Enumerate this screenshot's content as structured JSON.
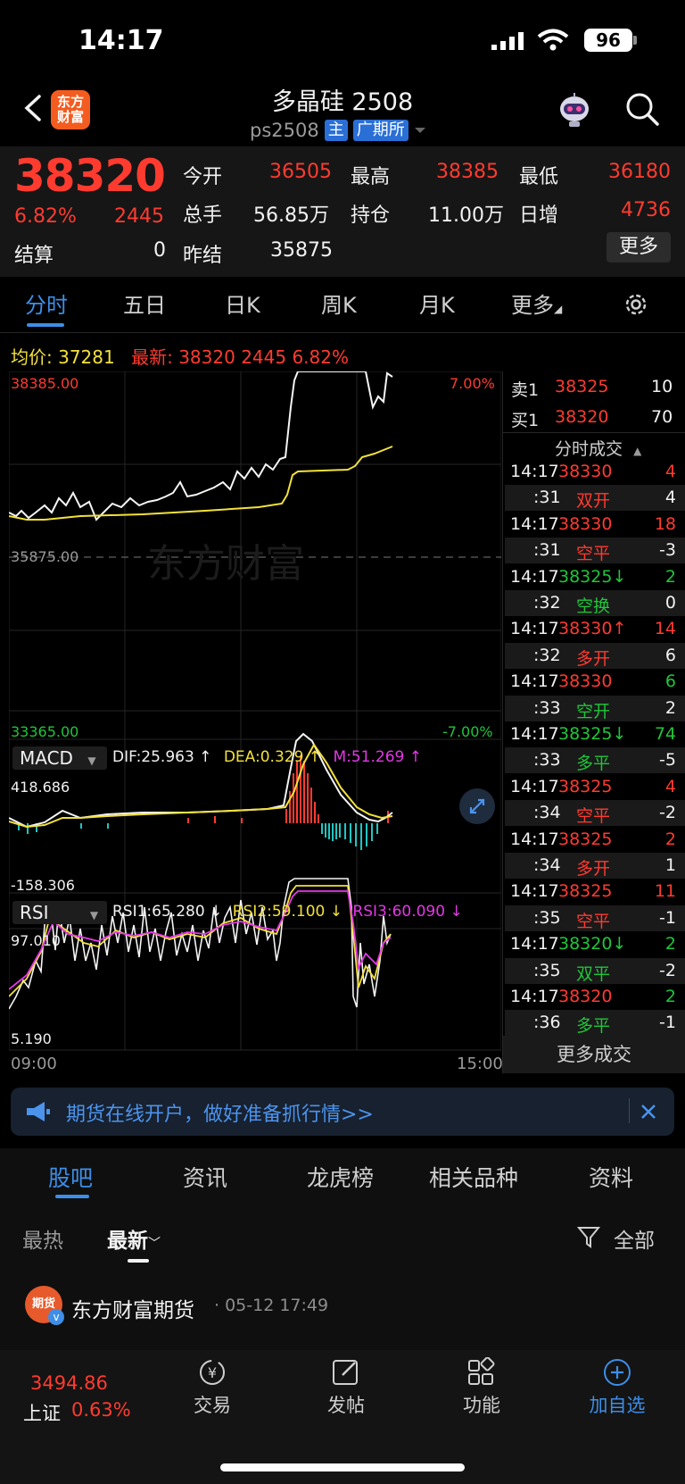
{
  "status_bar": {
    "time": "14:17",
    "battery": "96"
  },
  "header": {
    "logo_text": "东方财富",
    "title": "多晶硅 2508",
    "code": "ps2508",
    "tag_main": "主",
    "exchange": "广期所"
  },
  "quote": {
    "last_price": "38320",
    "change_pct": "6.82%",
    "change": "2445",
    "open_label": "今开",
    "open": "36505",
    "high_label": "最高",
    "high": "38385",
    "low_label": "最低",
    "low": "36180",
    "volume_label": "总手",
    "volume": "56.85万",
    "oi_label": "持仓",
    "oi": "11.00万",
    "daily_inc_label": "日增",
    "daily_inc": "4736",
    "settle_label": "结算",
    "settle": "0",
    "prev_settle_label": "昨结",
    "prev_settle": "35875",
    "more_label": "更多"
  },
  "tabs": [
    "分时",
    "五日",
    "日K",
    "周K",
    "月K",
    "更多"
  ],
  "avg_info": {
    "avg_label": "均价:",
    "avg": "37281",
    "latest_label": "最新:",
    "latest": "38320",
    "latest_chg": "2445",
    "latest_pct": "6.82%"
  },
  "price_chart": {
    "top_label": "38385.00",
    "top_pct": "7.00%",
    "mid_label": "35875.00",
    "bottom_label": "33365.00",
    "bottom_pct": "-7.00%",
    "watermark": "东方财富",
    "time_start": "09:00",
    "time_end": "15:00"
  },
  "macd": {
    "name": "MACD",
    "dif": "DIF:25.963 ↑",
    "dea": "DEA:0.329 ↑",
    "m": "M:51.269 ↑",
    "top": "418.686",
    "bottom": "-158.306"
  },
  "rsi": {
    "name": "RSI",
    "rsi1": "RSI1:65.280 ↓",
    "rsi2": "RSI2:59.100 ↓",
    "rsi3": "RSI3:60.090 ↓",
    "top": "97.010",
    "bottom": "5.190"
  },
  "order_book": {
    "sell_label": "卖1",
    "sell_price": "38325",
    "sell_vol": "10",
    "buy_label": "买1",
    "buy_price": "38320",
    "buy_vol": "70",
    "ticks_header": "分时成交",
    "more_trades": "更多成交",
    "ticks": [
      {
        "time": "14:17",
        "price": "38330",
        "price_color": "red",
        "vol": "4",
        "vol_color": "red"
      },
      {
        "time": ":31",
        "price": "双开",
        "price_color": "red",
        "vol": "4",
        "vol_color": "white"
      },
      {
        "time": "14:17",
        "price": "38330",
        "price_color": "red",
        "vol": "18",
        "vol_color": "red"
      },
      {
        "time": ":31",
        "price": "空平",
        "price_color": "red",
        "vol": "-3",
        "vol_color": "white"
      },
      {
        "time": "14:17",
        "price": "38325↓",
        "price_color": "green",
        "vol": "2",
        "vol_color": "green"
      },
      {
        "time": ":32",
        "price": "空换",
        "price_color": "green",
        "vol": "0",
        "vol_color": "white"
      },
      {
        "time": "14:17",
        "price": "38330↑",
        "price_color": "red",
        "vol": "14",
        "vol_color": "red"
      },
      {
        "time": ":32",
        "price": "多开",
        "price_color": "red",
        "vol": "6",
        "vol_color": "white"
      },
      {
        "time": "14:17",
        "price": "38330",
        "price_color": "red",
        "vol": "6",
        "vol_color": "green"
      },
      {
        "time": ":33",
        "price": "空开",
        "price_color": "green",
        "vol": "2",
        "vol_color": "white"
      },
      {
        "time": "14:17",
        "price": "38325↓",
        "price_color": "green",
        "vol": "74",
        "vol_color": "green"
      },
      {
        "time": ":33",
        "price": "多平",
        "price_color": "green",
        "vol": "-5",
        "vol_color": "white"
      },
      {
        "time": "14:17",
        "price": "38325",
        "price_color": "red",
        "vol": "4",
        "vol_color": "red"
      },
      {
        "time": ":34",
        "price": "空平",
        "price_color": "red",
        "vol": "-2",
        "vol_color": "white"
      },
      {
        "time": "14:17",
        "price": "38325",
        "price_color": "red",
        "vol": "2",
        "vol_color": "red"
      },
      {
        "time": ":34",
        "price": "多开",
        "price_color": "red",
        "vol": "1",
        "vol_color": "white"
      },
      {
        "time": "14:17",
        "price": "38325",
        "price_color": "red",
        "vol": "11",
        "vol_color": "red"
      },
      {
        "time": ":35",
        "price": "空平",
        "price_color": "red",
        "vol": "-1",
        "vol_color": "white"
      },
      {
        "time": "14:17",
        "price": "38320↓",
        "price_color": "green",
        "vol": "2",
        "vol_color": "green"
      },
      {
        "time": ":35",
        "price": "双平",
        "price_color": "green",
        "vol": "-2",
        "vol_color": "white"
      },
      {
        "time": "14:17",
        "price": "38320",
        "price_color": "red",
        "vol": "2",
        "vol_color": "green"
      },
      {
        "time": ":36",
        "price": "多平",
        "price_color": "green",
        "vol": "-1",
        "vol_color": "white"
      }
    ]
  },
  "banner": {
    "text": "期货在线开户，做好准备抓行情>>"
  },
  "lower_tabs": [
    "股吧",
    "资讯",
    "龙虎榜",
    "相关品种",
    "资料"
  ],
  "feed": {
    "hot": "最热",
    "latest": "最新",
    "filter": "全部",
    "author": "东方财富期货",
    "time": "· 05-12 17:49",
    "avatar_text": "期货"
  },
  "bottom_bar": {
    "index_value": "3494.86",
    "index_name": "上证",
    "index_pct": "0.63%",
    "trade": "交易",
    "post": "发帖",
    "func": "功能",
    "add": "加自选"
  },
  "colors": {
    "up": "#ff3b30",
    "down": "#1fc63a",
    "accent": "#3d8ee8",
    "avg_line": "#f3e13a"
  }
}
